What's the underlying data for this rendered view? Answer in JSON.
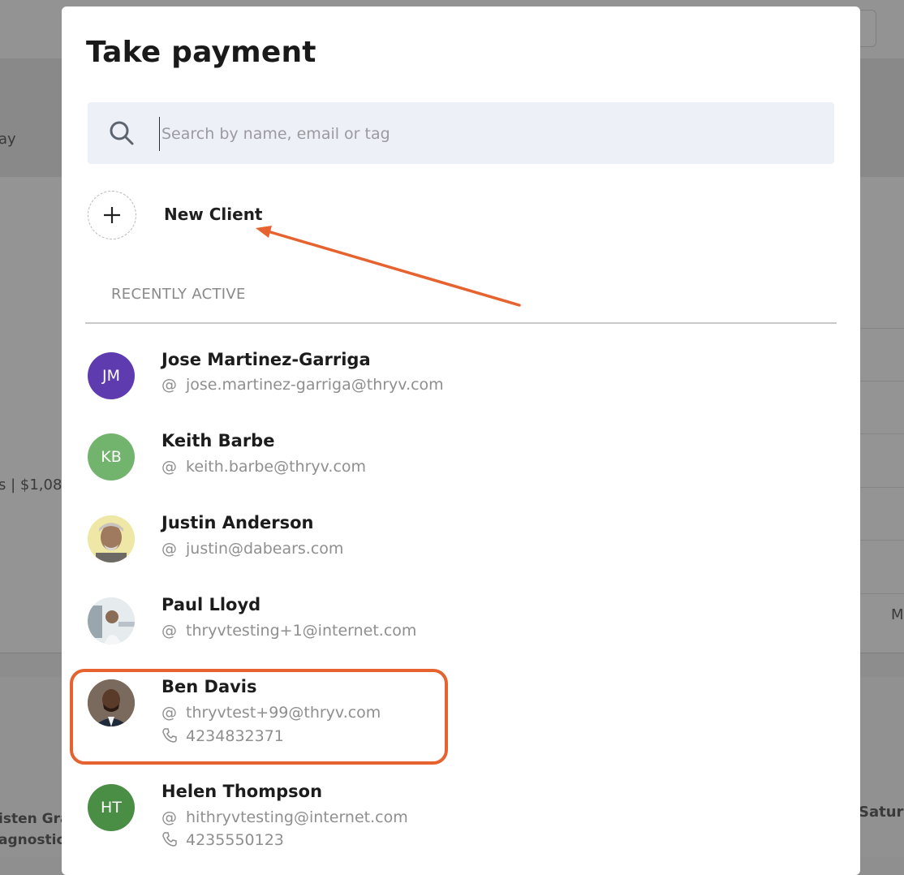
{
  "background": {
    "left_text_1": "ay",
    "left_text_2": "s  |  $1,08",
    "right_text_1": "M",
    "bottom_left_1": "isten Gra",
    "bottom_left_2": "agnostic",
    "bottom_right": "Satur"
  },
  "modal": {
    "title": "Take payment",
    "search": {
      "placeholder": "Search by name, email or tag",
      "value": ""
    },
    "new_client_label": "New Client",
    "section_label": "RECENTLY ACTIVE"
  },
  "clients": [
    {
      "name": "Jose Martinez-Garriga",
      "email": "jose.martinez-garriga@thryv.com",
      "initials": "JM",
      "avatar_color": "#5e3cb0"
    },
    {
      "name": "Keith Barbe",
      "email": "keith.barbe@thryv.com",
      "initials": "KB",
      "avatar_color": "#72b36e"
    },
    {
      "name": "Justin Anderson",
      "email": "justin@dabears.com",
      "avatar": "photo"
    },
    {
      "name": "Paul Lloyd",
      "email": "thryvtesting+1@internet.com",
      "avatar": "photo"
    },
    {
      "name": "Ben Davis",
      "email": "thryvtest+99@thryv.com",
      "phone": "4234832371",
      "avatar": "photo"
    },
    {
      "name": "Helen Thompson",
      "email": "hithryvtesting@internet.com",
      "phone": "4235550123",
      "initials": "HT",
      "avatar_color": "#4a8d44"
    }
  ],
  "symbols": {
    "at": "@"
  },
  "colors": {
    "annotation": "#e66330",
    "search_bg": "#eef0f7"
  }
}
